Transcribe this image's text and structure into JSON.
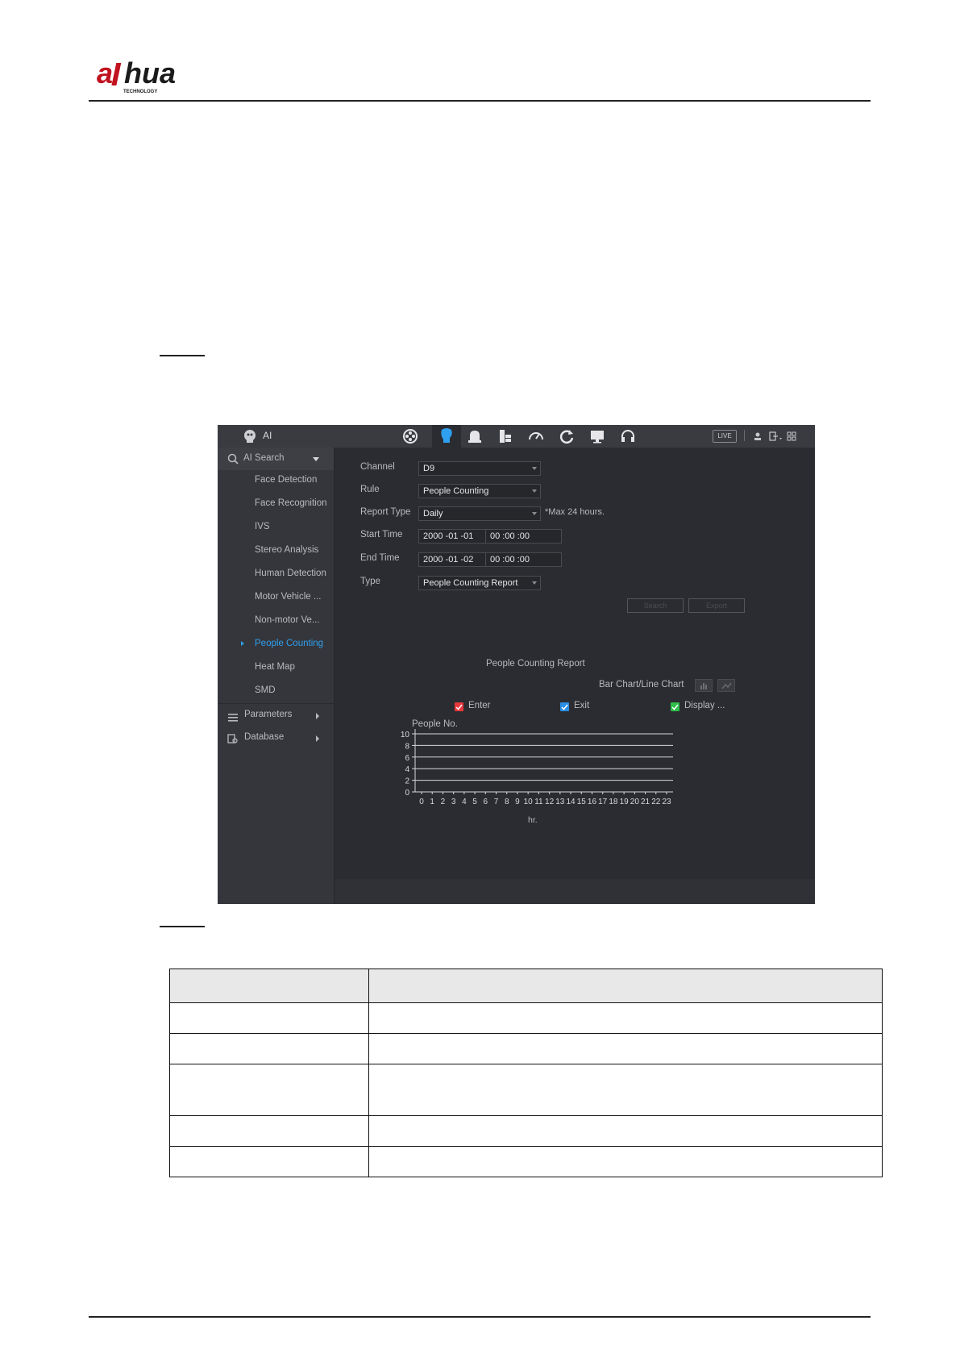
{
  "app": {
    "title": "AI",
    "live_label": "LIVE"
  },
  "toolbar_icons": [
    "film-reel-icon",
    "ai-head-icon",
    "alarm-bell-icon",
    "storage-icon",
    "speed-gauge-icon",
    "refresh-icon",
    "monitor-icon",
    "headset-icon"
  ],
  "sidebar": {
    "header": "AI Search",
    "items": [
      {
        "label": "Face Detection"
      },
      {
        "label": "Face Recognition"
      },
      {
        "label": "IVS"
      },
      {
        "label": "Stereo Analysis"
      },
      {
        "label": "Human Detection"
      },
      {
        "label": "Motor Vehicle ..."
      },
      {
        "label": "Non-motor Ve..."
      },
      {
        "label": "People Counting",
        "active": true
      },
      {
        "label": "Heat Map"
      },
      {
        "label": "SMD"
      }
    ],
    "parameters": "Parameters",
    "database": "Database"
  },
  "form": {
    "channel_label": "Channel",
    "channel_value": "D9",
    "rule_label": "Rule",
    "rule_value": "People Counting",
    "report_type_label": "Report Type",
    "report_type_value": "Daily",
    "max_note": "*Max 24 hours.",
    "start_label": "Start Time",
    "start_date": "2000 -01 -01",
    "start_time": "00 :00 :00",
    "end_label": "End Time",
    "end_date": "2000 -01 -02",
    "end_time": "00 :00 :00",
    "type_label": "Type",
    "type_value": "People Counting Report",
    "search_button": "Search",
    "export_button": "Export"
  },
  "report": {
    "title": "People Counting Report",
    "chart_toggle_label": "Bar Chart/Line Chart",
    "legend": [
      {
        "label": "Enter",
        "color": "#e8383b"
      },
      {
        "label": "Exit",
        "color": "#2a8ee6"
      },
      {
        "label": "Display ...",
        "color": "#2fbf4a"
      }
    ]
  },
  "chart_data": {
    "type": "line",
    "ylabel": "People No.",
    "xlabel": "hr.",
    "x": [
      0,
      1,
      2,
      3,
      4,
      5,
      6,
      7,
      8,
      9,
      10,
      11,
      12,
      13,
      14,
      15,
      16,
      17,
      18,
      19,
      20,
      21,
      22,
      23
    ],
    "ylim": [
      0,
      10
    ],
    "yticks": [
      0,
      2,
      4,
      6,
      8,
      10
    ],
    "series": [],
    "grid": true
  },
  "colors": {
    "accent": "#2fa0f0",
    "panel": "#2b2c31"
  }
}
